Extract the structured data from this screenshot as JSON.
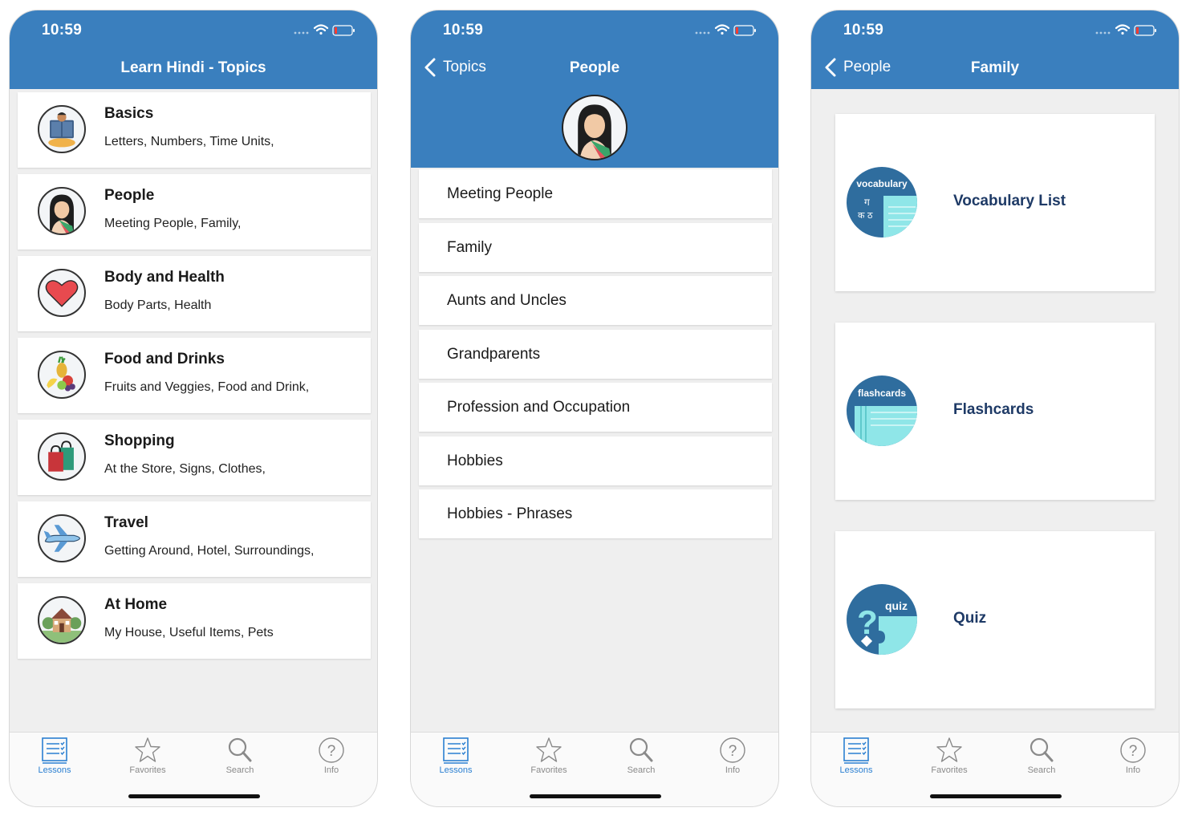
{
  "status_time": "10:59",
  "screen1": {
    "title": "Learn Hindi - Topics",
    "topics": [
      {
        "title": "Basics",
        "subtitle": "Letters, Numbers, Time Units,",
        "icon": "book-reader-icon"
      },
      {
        "title": "People",
        "subtitle": "Meeting People, Family,",
        "icon": "woman-avatar-icon"
      },
      {
        "title": "Body and Health",
        "subtitle": "Body Parts, Health",
        "icon": "heart-icon"
      },
      {
        "title": "Food and Drinks",
        "subtitle": "Fruits and Veggies, Food and Drink,",
        "icon": "fruit-basket-icon"
      },
      {
        "title": "Shopping",
        "subtitle": "At the Store, Signs, Clothes,",
        "icon": "shopping-bags-icon"
      },
      {
        "title": "Travel",
        "subtitle": "Getting Around, Hotel, Surroundings,",
        "icon": "airplane-icon"
      },
      {
        "title": "At Home",
        "subtitle": "My House, Useful Items, Pets",
        "icon": "house-icon"
      }
    ]
  },
  "screen2": {
    "back_label": "Topics",
    "title": "People",
    "items": [
      "Meeting People",
      "Family",
      "Aunts and Uncles",
      "Grandparents",
      "Profession and Occupation",
      "Hobbies",
      "Hobbies - Phrases"
    ]
  },
  "screen3": {
    "back_label": "People",
    "title": "Family",
    "cards": [
      {
        "label": "Vocabulary List",
        "icon_text": "vocabulary",
        "glyphs": [
          "ग",
          "क ठ"
        ]
      },
      {
        "label": "Flashcards",
        "icon_text": "flashcards"
      },
      {
        "label": "Quiz",
        "icon_text": "quiz"
      }
    ]
  },
  "tabbar": {
    "tabs": [
      {
        "label": "Lessons",
        "icon": "lessons-list-icon",
        "active": true
      },
      {
        "label": "Favorites",
        "icon": "star-icon",
        "active": false
      },
      {
        "label": "Search",
        "icon": "magnifier-icon",
        "active": false
      },
      {
        "label": "Info",
        "icon": "question-circle-icon",
        "active": false
      }
    ]
  },
  "colors": {
    "header_blue": "#3a7fbe",
    "tab_active": "#2a7fd1",
    "card_label": "#1e3a66",
    "icon_dark_blue": "#2f6d9e",
    "icon_light_teal": "#8fe6e8"
  }
}
